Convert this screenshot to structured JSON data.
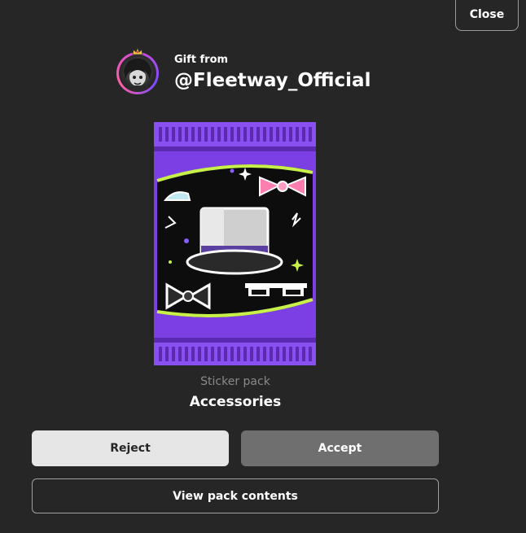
{
  "header": {
    "close_label": "Close"
  },
  "sender": {
    "gift_from_label": "Gift from",
    "username": "@Fleetway_Official"
  },
  "pack": {
    "type_label": "Sticker pack",
    "name": "Accessories"
  },
  "actions": {
    "reject_label": "Reject",
    "accept_label": "Accept",
    "view_contents_label": "View pack contents"
  },
  "icons": {
    "avatar": "user-avatar",
    "pack": "sticker-pack-art"
  },
  "colors": {
    "background": "#262626",
    "reject_bg": "#e6e6e6",
    "accept_bg": "#6f6f6f",
    "pack_purple": "#7b3fe4",
    "pack_lime": "#c8f04a"
  }
}
